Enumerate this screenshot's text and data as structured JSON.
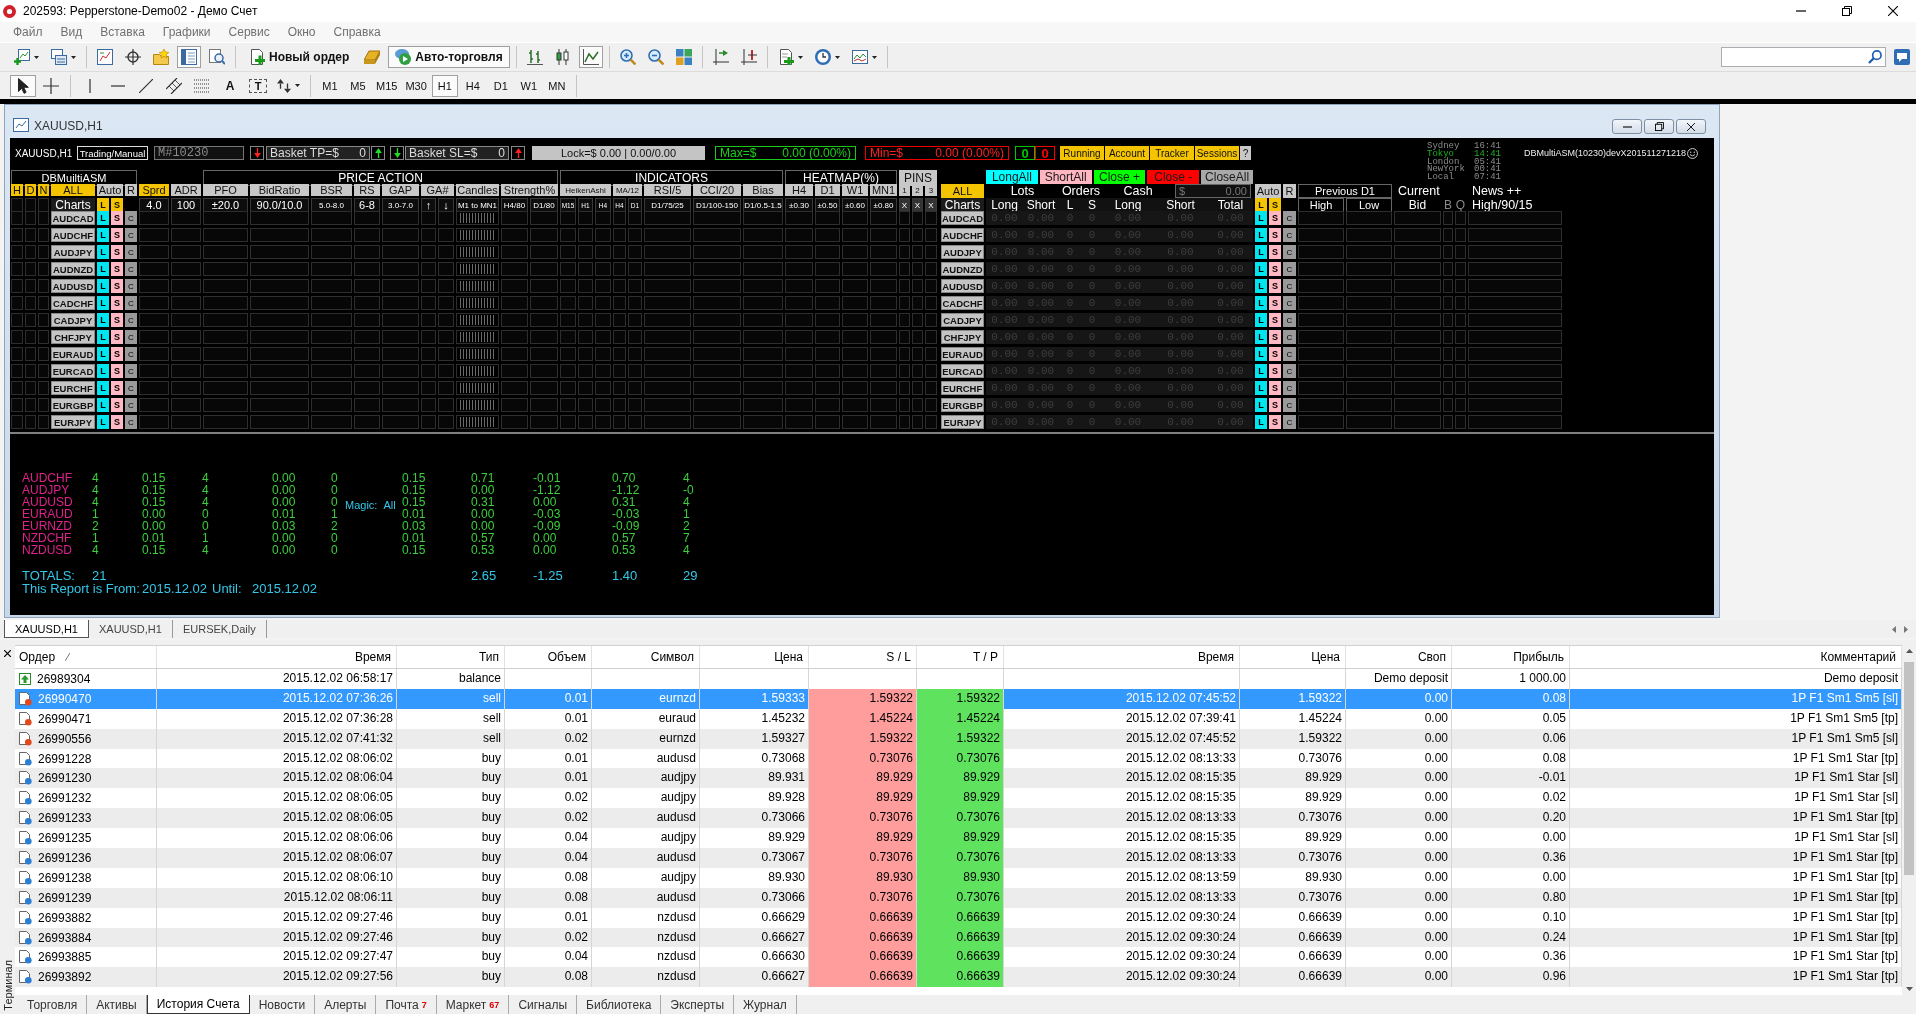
{
  "window": {
    "title": "202593: Pepperstone-Demo02 - Демо Счет"
  },
  "menu": [
    "Файл",
    "Вид",
    "Вставка",
    "Графики",
    "Сервис",
    "Окно",
    "Справка"
  ],
  "toolbar_1": [
    [
      {
        "pressed": false
      },
      {
        "pressed": false
      }
    ],
    [
      {
        "pressed": false
      },
      {
        "pressed": false
      },
      {
        "pressed": false
      },
      {
        "pressed": true
      },
      {
        "pressed": false
      }
    ],
    [
      {
        "label": "Новый ордер",
        "pressed": false
      },
      {
        "pressed": false
      },
      {
        "label": "Авто-торговля",
        "pressed": true
      }
    ],
    [
      {
        "pressed": false
      },
      {
        "pressed": false
      },
      {
        "pressed": true
      }
    ],
    [
      {
        "pressed": false
      },
      {
        "pressed": false
      },
      {
        "pressed": false
      }
    ],
    [
      {
        "pressed": false
      },
      {
        "pressed": false
      }
    ],
    [
      {
        "pressed": false
      },
      {
        "pressed": false
      },
      {
        "pressed": false
      }
    ]
  ],
  "toolbar_2": [
    [
      {
        "pressed": true
      },
      {
        "pressed": false
      }
    ],
    [
      {
        "pressed": false
      },
      {
        "pressed": false
      },
      {
        "pressed": false
      },
      {
        "pressed": false
      },
      {
        "pressed": false
      },
      {
        "label": "A",
        "pressed": false
      },
      {
        "label": "T",
        "pressed": false
      },
      {
        "pressed": false
      }
    ],
    [
      {
        "label": "M1",
        "pressed": false
      },
      {
        "label": "M5",
        "pressed": false
      },
      {
        "label": "M15",
        "pressed": false
      },
      {
        "label": "M30",
        "pressed": false
      },
      {
        "label": "H1",
        "pressed": true
      },
      {
        "label": "H4",
        "pressed": false
      },
      {
        "label": "D1",
        "pressed": false
      },
      {
        "label": "W1",
        "pressed": false
      },
      {
        "label": "MN",
        "pressed": false
      }
    ]
  ],
  "chart_window": {
    "title": "XAUUSD,H1"
  },
  "dashboard": {
    "symbol": "XAUUSD,H1",
    "mode": "Trading/Manual",
    "magic_input": {
      "value": "M#10230"
    },
    "basket_tp": {
      "label": "Basket TP=$",
      "value": "0"
    },
    "basket_sl": {
      "label": "Basket SL=$",
      "value": "0"
    },
    "lock": "Lock=$ 0.00 | 0.00/0.00",
    "max": {
      "label": "Max=$",
      "value": "0.00 (0.00%)"
    },
    "min": {
      "label": "Min=$",
      "value": "0.00 (0.00%)"
    },
    "counters": [
      {
        "value": "0",
        "color": "#00c800"
      },
      {
        "value": "0",
        "color": "#ff0000"
      }
    ],
    "toggles": [
      {
        "label": "Running",
        "on": true
      },
      {
        "label": "Account",
        "on": true
      },
      {
        "label": "Tracker",
        "on": true
      },
      {
        "label": "Sessions",
        "on": true
      }
    ],
    "help": "?",
    "sessions": [
      {
        "city": "Sydney",
        "time": "16:41",
        "open": false
      },
      {
        "city": "Tokyo",
        "time": "14:41",
        "open": true
      },
      {
        "city": "London",
        "time": "05:41",
        "open": false
      },
      {
        "city": "NewYork",
        "time": "00:41",
        "open": false
      },
      {
        "city": "Local",
        "time": "07:41",
        "open": false
      }
    ],
    "ea_name": "DBMultiASM(10230)devX201511271218",
    "title": "DBMuiltiASM",
    "groups": [
      "PRICE ACTION",
      "INDICATORS",
      "HEATMAP(%)",
      "PINS"
    ],
    "actions": [
      {
        "label": "LongAll",
        "color": "#00ffff"
      },
      {
        "label": "ShortAll",
        "color": "#ffb6c1"
      },
      {
        "label": "Close +",
        "color": "#00ff00"
      },
      {
        "label": "Close -",
        "color": "#ff0000"
      },
      {
        "label": "CloseAll",
        "color": "#a9a9a9"
      }
    ],
    "filters": [
      {
        "label": "H",
        "on": true
      },
      {
        "label": "D",
        "on": true
      },
      {
        "label": "N",
        "on": true
      },
      {
        "label": "ALL",
        "on": true
      },
      {
        "label": "Auto",
        "on": false
      },
      {
        "label": "R",
        "on": false
      },
      {
        "label": "Sprd",
        "on": true
      },
      {
        "label": "ADR",
        "on": false
      },
      {
        "label": "PFO",
        "on": false
      },
      {
        "label": "BidRatio",
        "on": false
      },
      {
        "label": "BSR",
        "on": false
      },
      {
        "label": "RS",
        "on": false
      },
      {
        "label": "GAP",
        "on": false
      },
      {
        "label": "GA#",
        "on": false
      },
      {
        "label": "Candles",
        "on": false
      },
      {
        "label": "Strength%",
        "on": false
      },
      {
        "label": "HeikenAshi",
        "on": false
      },
      {
        "label": "MA/12",
        "on": false
      },
      {
        "label": "RSI/5",
        "on": false
      },
      {
        "label": "CCI/20",
        "on": false
      },
      {
        "label": "Bias",
        "on": false
      },
      {
        "label": "H4",
        "on": false
      },
      {
        "label": "D1",
        "on": false
      },
      {
        "label": "W1",
        "on": false
      },
      {
        "label": "MN1",
        "on": false
      },
      {
        "label": "1",
        "on": false
      },
      {
        "label": "2",
        "on": false
      },
      {
        "label": "3",
        "on": false
      }
    ],
    "settings": {
      "label": "Charts",
      "toggles": [
        {
          "label": "L",
          "on": true
        },
        {
          "label": "S",
          "on": true
        }
      ],
      "values": [
        "4.0",
        "100",
        "±20.0",
        "90.0/10.0",
        "5.0-8.0",
        "6-8",
        "3.0-7.0",
        "↑",
        "↓",
        "M1 to MN1",
        "H4/80",
        "D1/80",
        "M15",
        "H1",
        "H4",
        "H4",
        "D1",
        "D1/75/25",
        "D1/100-150",
        "D1/0.5-1.5",
        "±0.30",
        "±0.50",
        "±0.60",
        "±0.80",
        "X",
        "X",
        "X"
      ]
    },
    "pairs": [
      {
        "symbol": "AUDCAD",
        "buttons": [
          "L",
          "S",
          "C"
        ]
      },
      {
        "symbol": "AUDCHF",
        "buttons": [
          "L",
          "S",
          "C"
        ]
      },
      {
        "symbol": "AUDJPY",
        "buttons": [
          "L",
          "S",
          "C"
        ]
      },
      {
        "symbol": "AUDNZD",
        "buttons": [
          "L",
          "S",
          "C"
        ]
      },
      {
        "symbol": "AUDUSD",
        "buttons": [
          "L",
          "S",
          "C"
        ]
      },
      {
        "symbol": "CADCHF",
        "buttons": [
          "L",
          "S",
          "C"
        ]
      },
      {
        "symbol": "CADJPY",
        "buttons": [
          "L",
          "S",
          "C"
        ]
      },
      {
        "symbol": "CHFJPY",
        "buttons": [
          "L",
          "S",
          "C"
        ]
      },
      {
        "symbol": "EURAUD",
        "buttons": [
          "L",
          "S",
          "C"
        ]
      },
      {
        "symbol": "EURCAD",
        "buttons": [
          "L",
          "S",
          "C"
        ]
      },
      {
        "symbol": "EURCHF",
        "buttons": [
          "L",
          "S",
          "C"
        ]
      },
      {
        "symbol": "EURGBP",
        "buttons": [
          "L",
          "S",
          "C"
        ]
      },
      {
        "symbol": "EURJPY",
        "buttons": [
          "L",
          "S",
          "C"
        ]
      }
    ],
    "summary_header": {
      "all": {
        "label": "ALL",
        "on": true
      },
      "groups": [
        "Lots",
        "Orders",
        "Cash"
      ],
      "cash": {
        "currency": "$",
        "value": "0.00"
      },
      "auto": {
        "label": "Auto",
        "on": false
      },
      "reset": {
        "label": "R",
        "on": false
      },
      "previous": "Previous D1",
      "current": "Current",
      "news": "News ++"
    },
    "summary_columns": {
      "charts": "Charts",
      "labels": [
        "Long",
        "Short",
        "L",
        "S",
        "Long",
        "Short",
        "Total"
      ],
      "toggles": [
        {
          "label": "L",
          "on": true
        },
        {
          "label": "S",
          "on": true
        }
      ],
      "prices": [
        "High",
        "Low",
        "Bid",
        "B",
        "Q",
        "High/90/15"
      ]
    },
    "summary_rows": [
      {
        "symbol": "AUDCAD",
        "values": [
          "0.00",
          "0.00",
          "0",
          "0",
          "0.00",
          "0.00",
          "0.00"
        ],
        "buttons": [
          "L",
          "S",
          "C"
        ]
      },
      {
        "symbol": "AUDCHF",
        "values": [
          "0.00",
          "0.00",
          "0",
          "0",
          "0.00",
          "0.00",
          "0.00"
        ],
        "buttons": [
          "L",
          "S",
          "C"
        ]
      },
      {
        "symbol": "AUDJPY",
        "values": [
          "0.00",
          "0.00",
          "0",
          "0",
          "0.00",
          "0.00",
          "0.00"
        ],
        "buttons": [
          "L",
          "S",
          "C"
        ]
      },
      {
        "symbol": "AUDNZD",
        "values": [
          "0.00",
          "0.00",
          "0",
          "0",
          "0.00",
          "0.00",
          "0.00"
        ],
        "buttons": [
          "L",
          "S",
          "C"
        ]
      },
      {
        "symbol": "AUDUSD",
        "values": [
          "0.00",
          "0.00",
          "0",
          "0",
          "0.00",
          "0.00",
          "0.00"
        ],
        "buttons": [
          "L",
          "S",
          "C"
        ]
      },
      {
        "symbol": "CADCHF",
        "values": [
          "0.00",
          "0.00",
          "0",
          "0",
          "0.00",
          "0.00",
          "0.00"
        ],
        "buttons": [
          "L",
          "S",
          "C"
        ]
      },
      {
        "symbol": "CADJPY",
        "values": [
          "0.00",
          "0.00",
          "0",
          "0",
          "0.00",
          "0.00",
          "0.00"
        ],
        "buttons": [
          "L",
          "S",
          "C"
        ]
      },
      {
        "symbol": "CHFJPY",
        "values": [
          "0.00",
          "0.00",
          "0",
          "0",
          "0.00",
          "0.00",
          "0.00"
        ],
        "buttons": [
          "L",
          "S",
          "C"
        ]
      },
      {
        "symbol": "EURAUD",
        "values": [
          "0.00",
          "0.00",
          "0",
          "0",
          "0.00",
          "0.00",
          "0.00"
        ],
        "buttons": [
          "L",
          "S",
          "C"
        ]
      },
      {
        "symbol": "EURCAD",
        "values": [
          "0.00",
          "0.00",
          "0",
          "0",
          "0.00",
          "0.00",
          "0.00"
        ],
        "buttons": [
          "L",
          "S",
          "C"
        ]
      },
      {
        "symbol": "EURCHF",
        "values": [
          "0.00",
          "0.00",
          "0",
          "0",
          "0.00",
          "0.00",
          "0.00"
        ],
        "buttons": [
          "L",
          "S",
          "C"
        ]
      },
      {
        "symbol": "EURGBP",
        "values": [
          "0.00",
          "0.00",
          "0",
          "0",
          "0.00",
          "0.00",
          "0.00"
        ],
        "buttons": [
          "L",
          "S",
          "C"
        ]
      },
      {
        "symbol": "EURJPY",
        "values": [
          "0.00",
          "0.00",
          "0",
          "0",
          "0.00",
          "0.00",
          "0.00"
        ],
        "buttons": [
          "L",
          "S",
          "C"
        ]
      }
    ]
  },
  "report": {
    "rows": [
      {
        "symbol": "AUDCHF",
        "values": [
          "4",
          "0.15",
          "4",
          "0.00",
          "0",
          "0.15",
          "0.71",
          "-0.01",
          "0.70",
          "4"
        ]
      },
      {
        "symbol": "AUDJPY",
        "values": [
          "4",
          "0.15",
          "4",
          "0.00",
          "0",
          "0.15",
          "0.00",
          "-1.12",
          "-1.12",
          "-0"
        ]
      },
      {
        "symbol": "AUDUSD",
        "values": [
          "4",
          "0.15",
          "4",
          "0.00",
          "0",
          "0.15",
          "0.31",
          "0.00",
          "0.31",
          "4"
        ]
      },
      {
        "symbol": "EURAUD",
        "values": [
          "1",
          "0.00",
          "0",
          "0.01",
          "1",
          "0.01",
          "0.00",
          "-0.03",
          "-0.03",
          "1"
        ]
      },
      {
        "symbol": "EURNZD",
        "values": [
          "2",
          "0.00",
          "0",
          "0.03",
          "2",
          "0.03",
          "0.00",
          "-0.09",
          "-0.09",
          "2"
        ]
      },
      {
        "symbol": "NZDCHF",
        "values": [
          "1",
          "0.01",
          "1",
          "0.00",
          "0",
          "0.01",
          "0.57",
          "0.00",
          "0.57",
          "7"
        ]
      },
      {
        "symbol": "NZDUSD",
        "values": [
          "4",
          "0.15",
          "4",
          "0.00",
          "0",
          "0.15",
          "0.53",
          "0.00",
          "0.53",
          "4"
        ]
      }
    ],
    "magic": {
      "label": "Magic:",
      "value": "All"
    },
    "totals": {
      "label": "TOTALS:",
      "count": "21",
      "sums": [
        "2.65",
        "-1.25",
        "1.40",
        "29"
      ]
    },
    "period": {
      "from_label": "This Report is From:",
      "from": "2015.12.02",
      "until_label": "Until:",
      "until": "2015.12.02"
    }
  },
  "chart_tabs": [
    {
      "label": "XAUUSD,H1",
      "selected": true
    },
    {
      "label": "XAUUSD,H1",
      "selected": false
    },
    {
      "label": "EURSEK,Daily",
      "selected": false
    }
  ],
  "terminal": {
    "title": "Терминал",
    "columns": [
      "Ордер",
      "Время",
      "Тип",
      "Объем",
      "Символ",
      "Цена",
      "S / L",
      "T / P",
      "Время",
      "Цена",
      "Своп",
      "Прибыль",
      "Комментарий"
    ],
    "rows": [
      {
        "kind": "balance",
        "selected": false,
        "order": "26989304",
        "time": "2015.12.02 06:58:17",
        "type": "balance",
        "swap": "Demo deposit",
        "profit": "1 000.00",
        "comment": "Demo deposit"
      },
      {
        "kind": "sell",
        "selected": true,
        "order": "26990470",
        "time": "2015.12.02 07:36:26",
        "type": "sell",
        "volume": "0.01",
        "symbol": "eurnzd",
        "price": "1.59333",
        "sl": "1.59322",
        "tp": "1.59322",
        "close_time": "2015.12.02 07:45:52",
        "close_price": "1.59322",
        "swap": "0.00",
        "profit": "0.08",
        "comment": "1P F1 Sm1 Sm5 [sl]"
      },
      {
        "kind": "sell",
        "selected": false,
        "order": "26990471",
        "time": "2015.12.02 07:36:28",
        "type": "sell",
        "volume": "0.01",
        "symbol": "euraud",
        "price": "1.45232",
        "sl": "1.45224",
        "tp": "1.45224",
        "close_time": "2015.12.02 07:39:41",
        "close_price": "1.45224",
        "swap": "0.00",
        "profit": "0.05",
        "comment": "1P F1 Sm1 Sm5 [tp]"
      },
      {
        "kind": "sell",
        "selected": false,
        "order": "26990556",
        "time": "2015.12.02 07:41:32",
        "type": "sell",
        "volume": "0.02",
        "symbol": "eurnzd",
        "price": "1.59327",
        "sl": "1.59322",
        "tp": "1.59322",
        "close_time": "2015.12.02 07:45:52",
        "close_price": "1.59322",
        "swap": "0.00",
        "profit": "0.06",
        "comment": "1P F1 Sm1 Sm5 [sl]"
      },
      {
        "kind": "buy",
        "selected": false,
        "order": "26991228",
        "time": "2015.12.02 08:06:02",
        "type": "buy",
        "volume": "0.01",
        "symbol": "audusd",
        "price": "0.73068",
        "sl": "0.73076",
        "tp": "0.73076",
        "close_time": "2015.12.02 08:13:33",
        "close_price": "0.73076",
        "swap": "0.00",
        "profit": "0.08",
        "comment": "1P F1 Sm1 Star [tp]"
      },
      {
        "kind": "buy",
        "selected": false,
        "order": "26991230",
        "time": "2015.12.02 08:06:04",
        "type": "buy",
        "volume": "0.01",
        "symbol": "audjpy",
        "price": "89.931",
        "sl": "89.929",
        "tp": "89.929",
        "close_time": "2015.12.02 08:15:35",
        "close_price": "89.929",
        "swap": "0.00",
        "profit": "-0.01",
        "comment": "1P F1 Sm1 Star [sl]"
      },
      {
        "kind": "buy",
        "selected": false,
        "order": "26991232",
        "time": "2015.12.02 08:06:05",
        "type": "buy",
        "volume": "0.02",
        "symbol": "audjpy",
        "price": "89.928",
        "sl": "89.929",
        "tp": "89.929",
        "close_time": "2015.12.02 08:15:35",
        "close_price": "89.929",
        "swap": "0.00",
        "profit": "0.02",
        "comment": "1P F1 Sm1 Star [sl]"
      },
      {
        "kind": "buy",
        "selected": false,
        "order": "26991233",
        "time": "2015.12.02 08:06:05",
        "type": "buy",
        "volume": "0.02",
        "symbol": "audusd",
        "price": "0.73066",
        "sl": "0.73076",
        "tp": "0.73076",
        "close_time": "2015.12.02 08:13:33",
        "close_price": "0.73076",
        "swap": "0.00",
        "profit": "0.20",
        "comment": "1P F1 Sm1 Star [tp]"
      },
      {
        "kind": "buy",
        "selected": false,
        "order": "26991235",
        "time": "2015.12.02 08:06:06",
        "type": "buy",
        "volume": "0.04",
        "symbol": "audjpy",
        "price": "89.929",
        "sl": "89.929",
        "tp": "89.929",
        "close_time": "2015.12.02 08:15:35",
        "close_price": "89.929",
        "swap": "0.00",
        "profit": "0.00",
        "comment": "1P F1 Sm1 Star [sl]"
      },
      {
        "kind": "buy",
        "selected": false,
        "order": "26991236",
        "time": "2015.12.02 08:06:07",
        "type": "buy",
        "volume": "0.04",
        "symbol": "audusd",
        "price": "0.73067",
        "sl": "0.73076",
        "tp": "0.73076",
        "close_time": "2015.12.02 08:13:33",
        "close_price": "0.73076",
        "swap": "0.00",
        "profit": "0.36",
        "comment": "1P F1 Sm1 Star [tp]"
      },
      {
        "kind": "buy",
        "selected": false,
        "order": "26991238",
        "time": "2015.12.02 08:06:10",
        "type": "buy",
        "volume": "0.08",
        "symbol": "audjpy",
        "price": "89.930",
        "sl": "89.930",
        "tp": "89.930",
        "close_time": "2015.12.02 08:13:59",
        "close_price": "89.930",
        "swap": "0.00",
        "profit": "0.00",
        "comment": "1P F1 Sm1 Star [tp]"
      },
      {
        "kind": "buy",
        "selected": false,
        "order": "26991239",
        "time": "2015.12.02 08:06:11",
        "type": "buy",
        "volume": "0.08",
        "symbol": "audusd",
        "price": "0.73066",
        "sl": "0.73076",
        "tp": "0.73076",
        "close_time": "2015.12.02 08:13:33",
        "close_price": "0.73076",
        "swap": "0.00",
        "profit": "0.80",
        "comment": "1P F1 Sm1 Star [tp]"
      },
      {
        "kind": "buy",
        "selected": false,
        "order": "26993882",
        "time": "2015.12.02 09:27:46",
        "type": "buy",
        "volume": "0.01",
        "symbol": "nzdusd",
        "price": "0.66629",
        "sl": "0.66639",
        "tp": "0.66639",
        "close_time": "2015.12.02 09:30:24",
        "close_price": "0.66639",
        "swap": "0.00",
        "profit": "0.10",
        "comment": "1P F1 Sm1 Star [tp]"
      },
      {
        "kind": "buy",
        "selected": false,
        "order": "26993884",
        "time": "2015.12.02 09:27:46",
        "type": "buy",
        "volume": "0.02",
        "symbol": "nzdusd",
        "price": "0.66627",
        "sl": "0.66639",
        "tp": "0.66639",
        "close_time": "2015.12.02 09:30:24",
        "close_price": "0.66639",
        "swap": "0.00",
        "profit": "0.24",
        "comment": "1P F1 Sm1 Star [tp]"
      },
      {
        "kind": "buy",
        "selected": false,
        "order": "26993885",
        "time": "2015.12.02 09:27:47",
        "type": "buy",
        "volume": "0.04",
        "symbol": "nzdusd",
        "price": "0.66630",
        "sl": "0.66639",
        "tp": "0.66639",
        "close_time": "2015.12.02 09:30:24",
        "close_price": "0.66639",
        "swap": "0.00",
        "profit": "0.36",
        "comment": "1P F1 Sm1 Star [tp]"
      },
      {
        "kind": "buy",
        "selected": false,
        "order": "26993892",
        "time": "2015.12.02 09:27:56",
        "type": "buy",
        "volume": "0.08",
        "symbol": "nzdusd",
        "price": "0.66627",
        "sl": "0.66639",
        "tp": "0.66639",
        "close_time": "2015.12.02 09:30:24",
        "close_price": "0.66639",
        "swap": "0.00",
        "profit": "0.96",
        "comment": "1P F1 Sm1 Star [tp]"
      }
    ],
    "tabs": [
      {
        "label": "Торговля",
        "selected": false
      },
      {
        "label": "Активы",
        "selected": false
      },
      {
        "label": "История Счета",
        "selected": true
      },
      {
        "label": "Новости",
        "selected": false
      },
      {
        "label": "Алерты",
        "selected": false
      },
      {
        "label": "Почта",
        "badge": "7",
        "selected": false
      },
      {
        "label": "Маркет",
        "badge": "67",
        "selected": false
      },
      {
        "label": "Сигналы",
        "selected": false
      },
      {
        "label": "Библиотека",
        "selected": false
      },
      {
        "label": "Эксперты",
        "selected": false
      },
      {
        "label": "Журнал",
        "selected": false
      }
    ]
  }
}
